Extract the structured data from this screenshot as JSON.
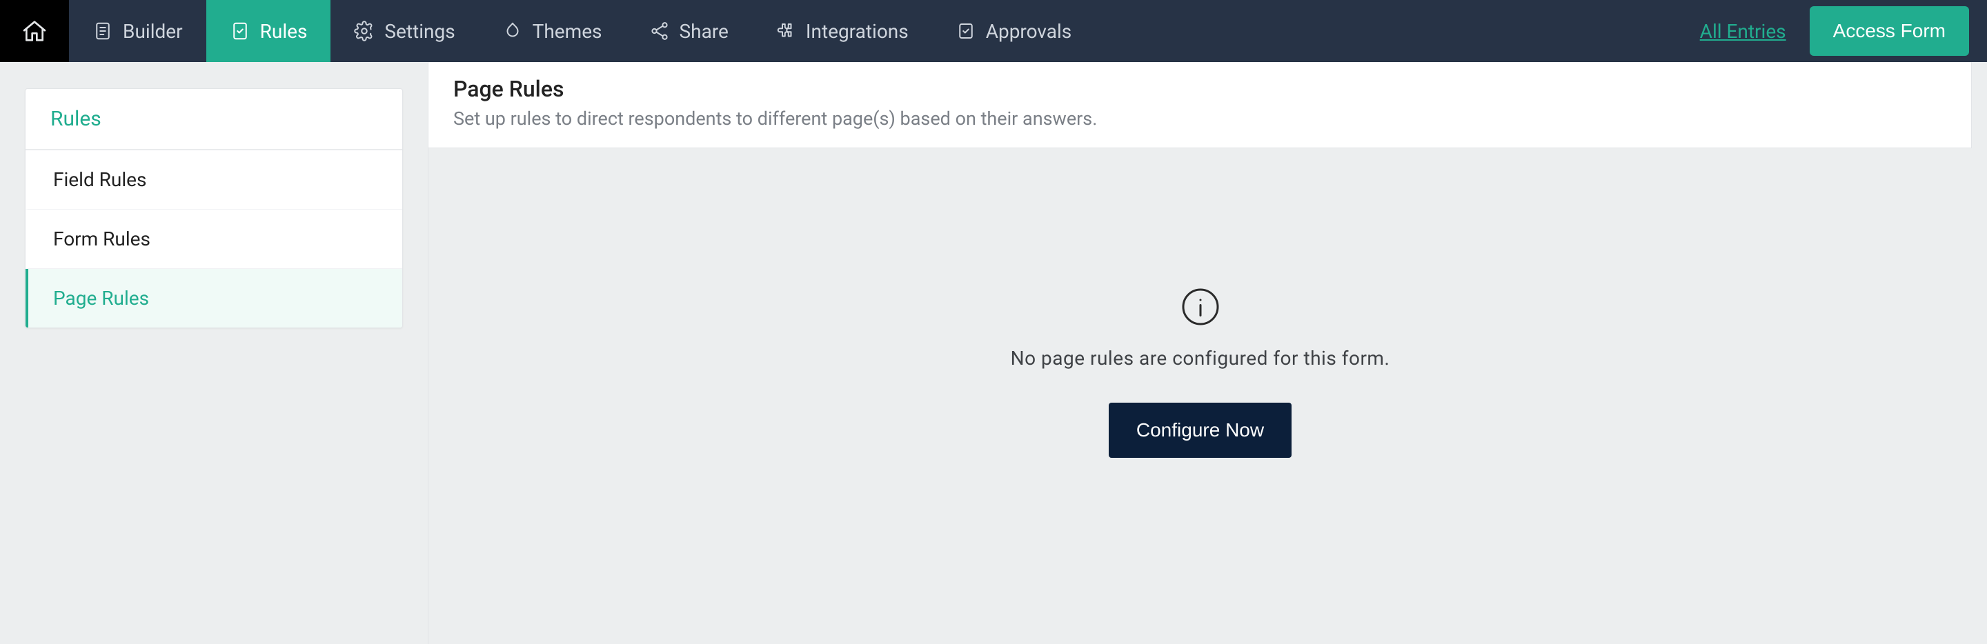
{
  "nav": {
    "items": [
      {
        "label": "Builder"
      },
      {
        "label": "Rules"
      },
      {
        "label": "Settings"
      },
      {
        "label": "Themes"
      },
      {
        "label": "Share"
      },
      {
        "label": "Integrations"
      },
      {
        "label": "Approvals"
      }
    ],
    "all_entries": "All Entries",
    "access_form": "Access Form"
  },
  "sidebar": {
    "title": "Rules",
    "items": [
      {
        "label": "Field Rules"
      },
      {
        "label": "Form Rules"
      },
      {
        "label": "Page Rules"
      }
    ]
  },
  "main": {
    "title": "Page Rules",
    "subtitle": "Set up rules to direct respondents to different page(s) based on their answers.",
    "empty_message": "No page rules are configured for this form.",
    "configure_label": "Configure Now"
  }
}
